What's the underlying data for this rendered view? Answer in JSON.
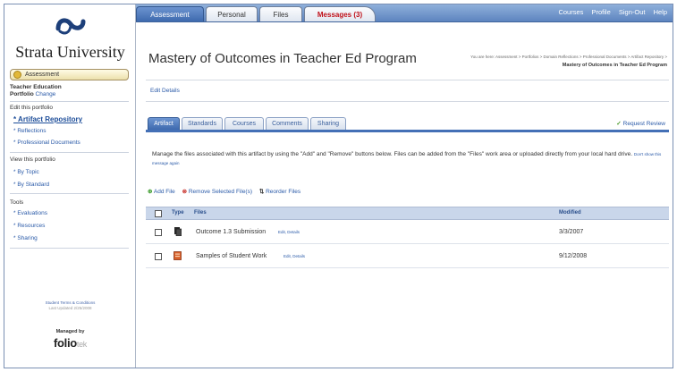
{
  "top_nav": {
    "tabs": [
      {
        "label": "Assessment",
        "active": true
      },
      {
        "label": "Personal",
        "active": false
      },
      {
        "label": "Files",
        "active": false
      },
      {
        "label": "Messages (3)",
        "active": false,
        "alert": true
      }
    ],
    "links": [
      "Courses",
      "Profile",
      "Sign-Out",
      "Help"
    ]
  },
  "brand": {
    "university": "Strata University"
  },
  "sidebar": {
    "module": "Assessment",
    "portfolio_title_line1": "Teacher Education",
    "portfolio_title_line2": "Portfolio",
    "change_label": "Change",
    "edit_heading": "Edit this portfolio",
    "edit_items": [
      "* Artifact Repository",
      "* Reflections",
      "* Professional Documents"
    ],
    "view_heading": "View this portfolio",
    "view_items": [
      "* By Topic",
      "* By Standard"
    ],
    "tools_heading": "Tools",
    "tools_items": [
      "* Evaluations",
      "* Resources",
      "* Sharing"
    ],
    "terms_label": "Student Terms & Conditions",
    "updated_label": "Last Updated 2/25/2008",
    "managed_by": "Managed by",
    "folio_word": "folio",
    "folio_suffix": "tek"
  },
  "main": {
    "page_title": "Mastery of Outcomes in Teacher Ed Program",
    "breadcrumb_line1": "You are here: Assessment > Portfolios > Domain Reflections > Professional Documents > Artifact Repository >",
    "breadcrumb_line2": "Mastery of Outcomes in Teacher Ed Program",
    "edit_details": "Edit Details",
    "tabs": [
      {
        "label": "Artifact",
        "active": true
      },
      {
        "label": "Standards",
        "active": false
      },
      {
        "label": "Courses",
        "active": false
      },
      {
        "label": "Comments",
        "active": false
      },
      {
        "label": "Sharing",
        "active": false
      }
    ],
    "request_review": "Request Review",
    "description": "Manage the files associated with this artifact by using the \"Add\" and \"Remove\" buttons below. Files can be added from the \"Files\" work area or uploaded directly from your local hard drive.",
    "dismiss": "Don't show this message again",
    "actions": {
      "add": "Add File",
      "remove": "Remove Selected File(s)",
      "reorder": "Reorder Files"
    },
    "table": {
      "col_type": "Type",
      "col_files": "Files",
      "col_modified": "Modified",
      "rows": [
        {
          "name": "Outcome 1.3 Submission",
          "edit": "Edit",
          "details": "Details",
          "modified": "3/3/2007",
          "icon": "document-icon"
        },
        {
          "name": "Samples of Student Work",
          "edit": "Edit",
          "details": "Details",
          "modified": "9/12/2008",
          "icon": "archive-icon"
        }
      ]
    }
  },
  "colors": {
    "nav_blue": "#4470b6",
    "link_blue": "#2a5aa8",
    "alert_red": "#c0111a"
  }
}
